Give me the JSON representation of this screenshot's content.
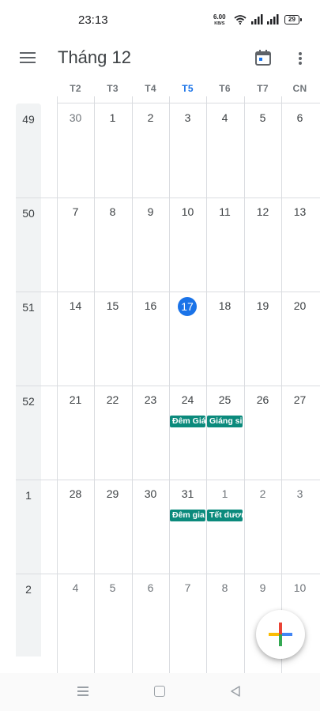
{
  "status_bar": {
    "time": "23:13",
    "net_speed_value": "6.00",
    "net_speed_unit": "KB/S",
    "battery": "29"
  },
  "app_bar": {
    "title": "Tháng 12",
    "menu_icon": "hamburger-menu-icon",
    "today_icon": "calendar-today-icon",
    "more_icon": "more-vert-icon"
  },
  "weekdays": [
    "T2",
    "T3",
    "T4",
    "T5",
    "T6",
    "T7",
    "CN"
  ],
  "today_column": "T5",
  "weeks": [
    {
      "week": "49",
      "days": [
        "30",
        "1",
        "2",
        "3",
        "4",
        "5",
        "6"
      ]
    },
    {
      "week": "50",
      "days": [
        "7",
        "8",
        "9",
        "10",
        "11",
        "12",
        "13"
      ]
    },
    {
      "week": "51",
      "days": [
        "14",
        "15",
        "16",
        "17",
        "18",
        "19",
        "20"
      ]
    },
    {
      "week": "52",
      "days": [
        "21",
        "22",
        "23",
        "24",
        "25",
        "26",
        "27"
      ]
    },
    {
      "week": "1",
      "days": [
        "28",
        "29",
        "30",
        "31",
        "1",
        "2",
        "3"
      ]
    },
    {
      "week": "2",
      "days": [
        "4",
        "5",
        "6",
        "7",
        "8",
        "9",
        "10"
      ]
    }
  ],
  "today": "17",
  "events": [
    {
      "title": "Đêm Giá",
      "day": "24"
    },
    {
      "title": "Giáng si",
      "day": "25"
    },
    {
      "title": "Đêm gia",
      "day": "31"
    },
    {
      "title": "Tết dươn",
      "day": "1"
    }
  ],
  "fab_icon": "google-plus-add-icon",
  "colors": {
    "accent": "#1a73e8",
    "event": "#0b8a7c",
    "grid": "#dadce0",
    "week_column": "#f1f3f4",
    "fab_blue": "#4285f4",
    "fab_red": "#ea4335",
    "fab_yellow": "#fbbc04",
    "fab_green": "#34a853"
  },
  "nav_bar": {
    "menu_icon": "nav-menu-icon",
    "home_icon": "nav-home-icon",
    "back_icon": "nav-back-icon"
  }
}
